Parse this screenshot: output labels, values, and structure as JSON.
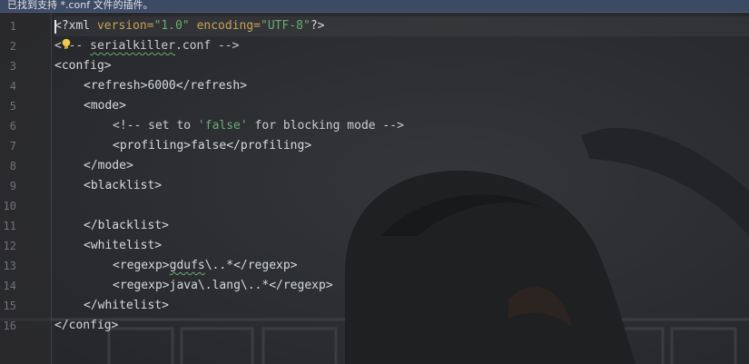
{
  "banner": {
    "text": "已找到支持 *.conf 文件的插件。"
  },
  "editor": {
    "current_line": 1,
    "lines": [
      {
        "num": "1",
        "indent": 0,
        "tokens": [
          {
            "t": "<?xml ",
            "c": "tag"
          },
          {
            "t": "version=",
            "c": "attr"
          },
          {
            "t": "\"1.0\"",
            "c": "val"
          },
          {
            "t": " ",
            "c": "tag"
          },
          {
            "t": "encoding=",
            "c": "attr"
          },
          {
            "t": "\"UTF-8\"",
            "c": "val"
          },
          {
            "t": "?>",
            "c": "tag"
          }
        ]
      },
      {
        "num": "2",
        "indent": 0,
        "tokens": [
          {
            "t": "<!-- ",
            "c": "comment"
          },
          {
            "t": "serialkiller",
            "c": "comment squig"
          },
          {
            "t": ".conf -->",
            "c": "comment"
          }
        ]
      },
      {
        "num": "3",
        "indent": 0,
        "tokens": [
          {
            "t": "<config>",
            "c": "tag"
          }
        ]
      },
      {
        "num": "4",
        "indent": 1,
        "tokens": [
          {
            "t": "<refresh>",
            "c": "tag"
          },
          {
            "t": "6000",
            "c": "text"
          },
          {
            "t": "</refresh>",
            "c": "tag"
          }
        ]
      },
      {
        "num": "5",
        "indent": 1,
        "tokens": [
          {
            "t": "<mode>",
            "c": "tag"
          }
        ]
      },
      {
        "num": "6",
        "indent": 2,
        "tokens": [
          {
            "t": "<!-- set to ",
            "c": "comment"
          },
          {
            "t": "'false'",
            "c": "cstr"
          },
          {
            "t": " for blocking mode -->",
            "c": "comment"
          }
        ]
      },
      {
        "num": "7",
        "indent": 2,
        "tokens": [
          {
            "t": "<profiling>",
            "c": "tag"
          },
          {
            "t": "false",
            "c": "text"
          },
          {
            "t": "</profiling>",
            "c": "tag"
          }
        ]
      },
      {
        "num": "8",
        "indent": 1,
        "tokens": [
          {
            "t": "</mode>",
            "c": "tag"
          }
        ]
      },
      {
        "num": "9",
        "indent": 1,
        "tokens": [
          {
            "t": "<blacklist>",
            "c": "tag"
          }
        ]
      },
      {
        "num": "10",
        "indent": 0,
        "tokens": []
      },
      {
        "num": "11",
        "indent": 1,
        "tokens": [
          {
            "t": "</blacklist>",
            "c": "tag"
          }
        ]
      },
      {
        "num": "12",
        "indent": 1,
        "tokens": [
          {
            "t": "<whitelist>",
            "c": "tag"
          }
        ]
      },
      {
        "num": "13",
        "indent": 2,
        "tokens": [
          {
            "t": "<regexp>",
            "c": "tag"
          },
          {
            "t": "gdufs",
            "c": "text squig"
          },
          {
            "t": "\\..*",
            "c": "text"
          },
          {
            "t": "</regexp>",
            "c": "tag"
          }
        ]
      },
      {
        "num": "14",
        "indent": 2,
        "tokens": [
          {
            "t": "<regexp>",
            "c": "tag"
          },
          {
            "t": "java\\.lang\\..*",
            "c": "text"
          },
          {
            "t": "</regexp>",
            "c": "tag"
          }
        ]
      },
      {
        "num": "15",
        "indent": 1,
        "tokens": [
          {
            "t": "</whitelist>",
            "c": "tag"
          }
        ]
      },
      {
        "num": "16",
        "indent": 0,
        "tokens": [
          {
            "t": "</config>",
            "c": "tag"
          }
        ]
      }
    ]
  },
  "icons": {
    "intention": "lightbulb-icon"
  },
  "colors": {
    "background": "#2b2c2e",
    "banner": "#3d4a63",
    "attribute": "#c8a15a",
    "string": "#6aab73",
    "bulb": "#f2c94c"
  }
}
